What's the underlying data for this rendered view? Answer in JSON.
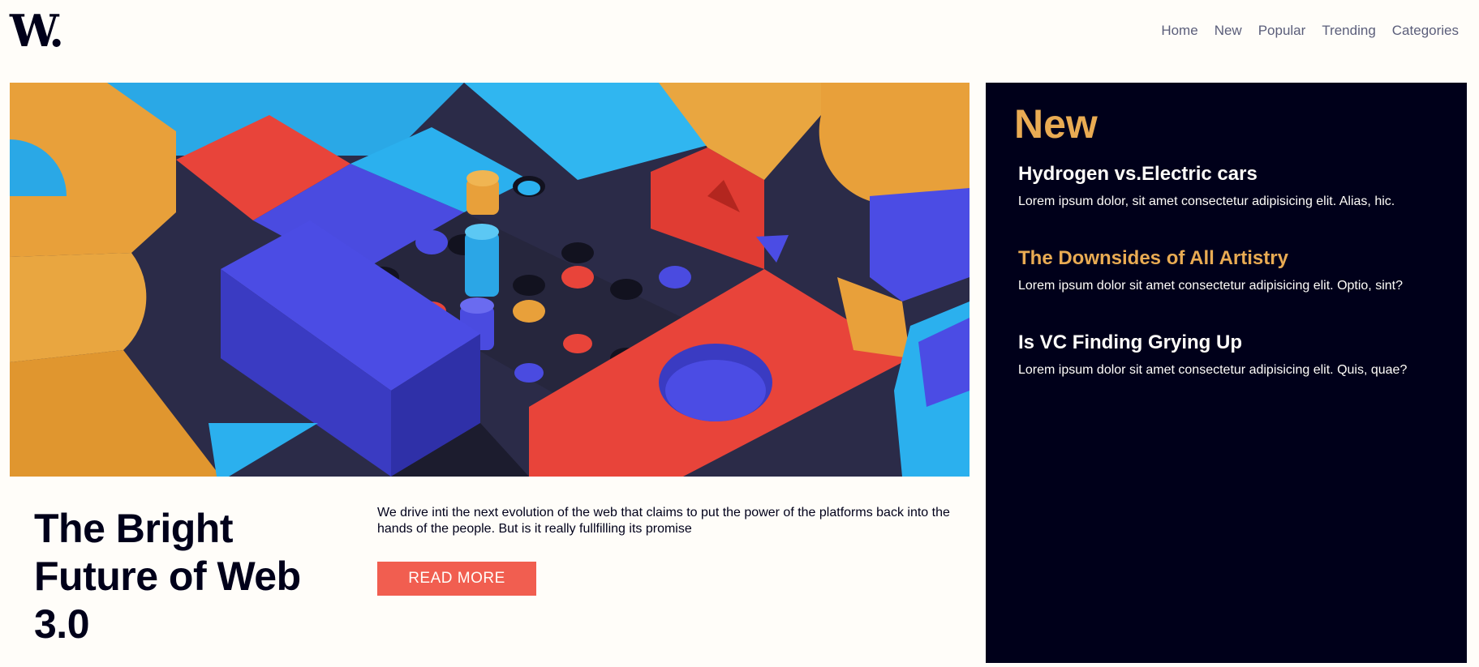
{
  "header": {
    "logo": "W.",
    "nav": [
      "Home",
      "New",
      "Popular",
      "Trending",
      "Categories"
    ]
  },
  "hero": {
    "image_alt": "abstract 3D colored blocks",
    "title": "The Bright Future of Web 3.0",
    "description": "We drive inti the next evolution of the web that claims to put the power of the platforms back into the hands of the people. But is it really fullfilling its promise",
    "button_label": "READ MORE"
  },
  "sidebar": {
    "title": "New",
    "articles": [
      {
        "title": "Hydrogen vs.Electric cars",
        "summary": "Lorem ipsum dolor, sit amet consectetur adipisicing elit. Alias, hic."
      },
      {
        "title": "The Downsides of All Artistry",
        "summary": "Lorem ipsum dolor sit amet consectetur adipisicing elit. Optio, sint?"
      },
      {
        "title": "Is VC Finding Grying Up",
        "summary": "Lorem ipsum dolor sit amet consectetur adipisicing elit. Quis, quae?"
      }
    ]
  },
  "colors": {
    "background": "#fffdf9",
    "dark": "#00001a",
    "accent_orange": "#e9ab53",
    "accent_red": "#f15e50",
    "nav_text": "#5b5e7a"
  }
}
